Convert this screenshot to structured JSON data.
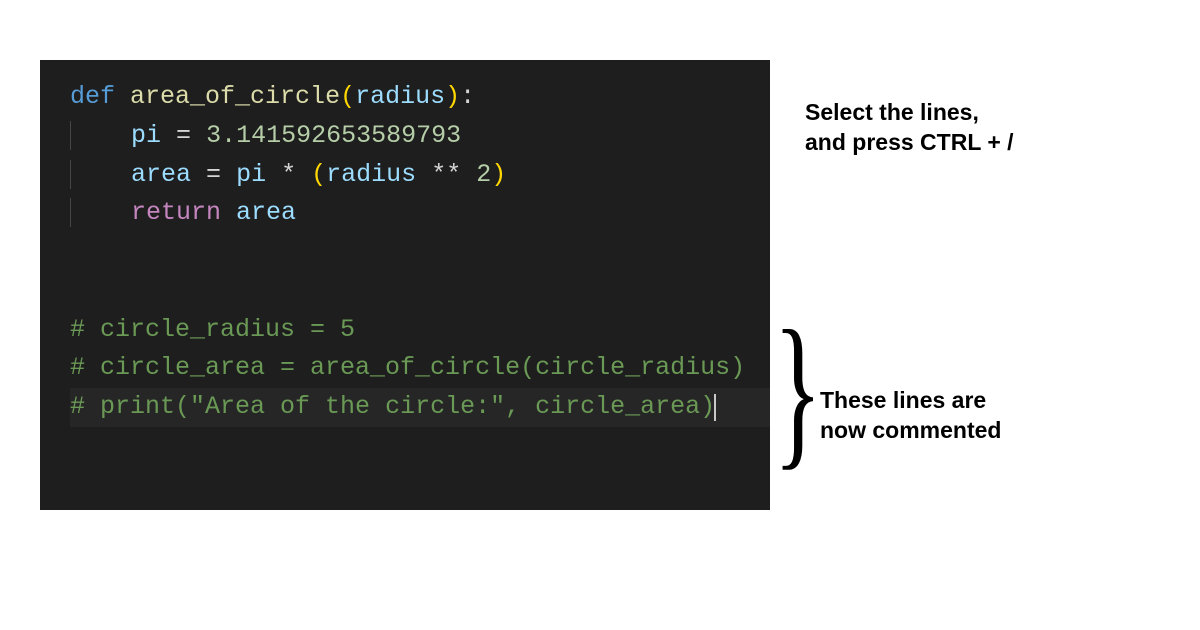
{
  "code": {
    "line1": {
      "kw": "def",
      "sp": " ",
      "fn": "area_of_circle",
      "open": "(",
      "param": "radius",
      "close": ")",
      "colon": ":"
    },
    "line2": {
      "indent": "    ",
      "var": "pi",
      "sp1": " ",
      "op": "=",
      "sp2": " ",
      "num": "3.141592653589793"
    },
    "line3": {
      "indent": "    ",
      "var": "area",
      "sp1": " ",
      "eq": "=",
      "sp2": " ",
      "pi": "pi",
      "sp3": " ",
      "mul": "*",
      "sp4": " ",
      "open": "(",
      "radius": "radius",
      "sp5": " ",
      "pow": "**",
      "sp6": " ",
      "two": "2",
      "close": ")"
    },
    "line4": {
      "indent": "    ",
      "ret": "return",
      "sp": " ",
      "var": "area"
    },
    "comment1": "# circle_radius = 5",
    "comment2": "# circle_area = area_of_circle(circle_radius)",
    "comment3_a": "# print(",
    "comment3_str": "\"Area of the circle:\"",
    "comment3_b": ", circle_area)"
  },
  "annotations": {
    "top_line1": "Select the lines,",
    "top_line2": "and press CTRL + /",
    "bottom_line1": "These lines are",
    "bottom_line2": "now commented",
    "brace": "}"
  }
}
